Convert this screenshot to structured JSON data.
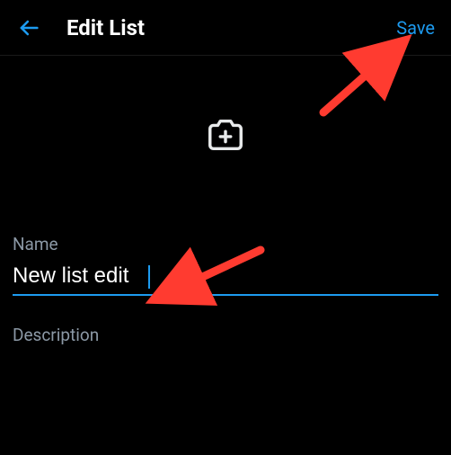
{
  "header": {
    "title": "Edit List",
    "save_label": "Save"
  },
  "form": {
    "name_label": "Name",
    "name_value": "New list edit",
    "description_label": "Description",
    "description_value": ""
  },
  "icons": {
    "back": "arrow-left",
    "camera": "camera-plus"
  },
  "accent_color": "#1d9bf0"
}
